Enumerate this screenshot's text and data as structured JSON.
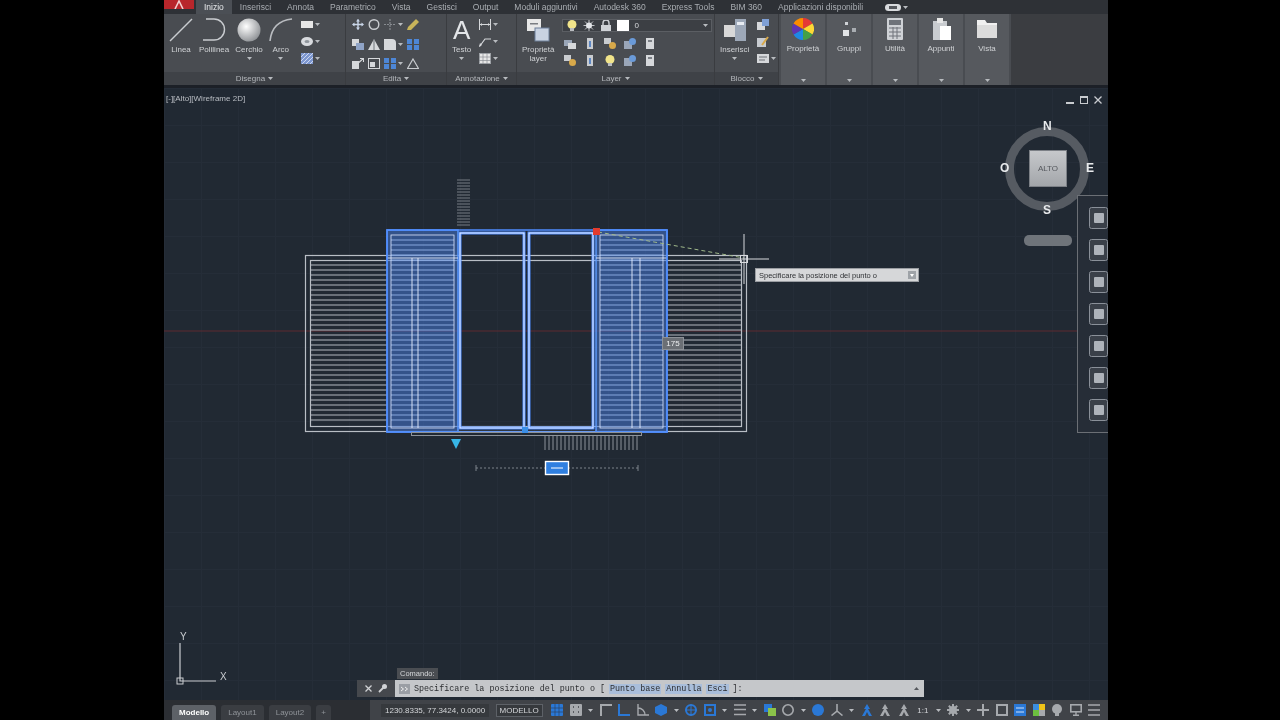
{
  "ribbon_tabs": [
    {
      "label": "Inizio",
      "selected": true
    },
    {
      "label": "Inserisci",
      "selected": false
    },
    {
      "label": "Annota",
      "selected": false
    },
    {
      "label": "Parametrico",
      "selected": false
    },
    {
      "label": "Vista",
      "selected": false
    },
    {
      "label": "Gestisci",
      "selected": false
    },
    {
      "label": "Output",
      "selected": false
    },
    {
      "label": "Moduli aggiuntivi",
      "selected": false
    },
    {
      "label": "Autodesk 360",
      "selected": false
    },
    {
      "label": "Express Tools",
      "selected": false
    },
    {
      "label": "BIM 360",
      "selected": false
    },
    {
      "label": "Applicazioni disponibili",
      "selected": false
    }
  ],
  "ribbon_panels": [
    {
      "kind": "draw",
      "title": "Disegna",
      "tools": [
        {
          "kind": "line",
          "label": "Linea",
          "menu": false
        },
        {
          "kind": "polyline",
          "label": "Polilinea",
          "menu": false
        },
        {
          "kind": "circle",
          "label": "Cerchio",
          "menu": true
        },
        {
          "kind": "arc",
          "label": "Arco",
          "menu": true
        }
      ]
    },
    {
      "kind": "edit",
      "title": "Edita"
    },
    {
      "kind": "annotation",
      "title": "Annotazione",
      "tools": [
        {
          "kind": "text",
          "glyph": "A",
          "label": "Testo",
          "menu": true
        }
      ]
    },
    {
      "kind": "layer",
      "title": "Layer",
      "tools": [
        {
          "kind": "layer-properties",
          "label": "Proprietà layer",
          "menu": false
        }
      ],
      "current_layer": "0"
    },
    {
      "kind": "block",
      "title": "Blocco",
      "tools": [
        {
          "kind": "insert",
          "label": "Inserisci",
          "menu": true
        }
      ]
    },
    {
      "kind": "properties",
      "label": "Proprietà"
    },
    {
      "kind": "groups",
      "label": "Gruppi"
    },
    {
      "kind": "utilities",
      "label": "Utilità"
    },
    {
      "kind": "clipboard",
      "label": "Appunti"
    },
    {
      "kind": "view",
      "label": "Vista"
    }
  ],
  "viewport": {
    "label": "[-][Alto][Wireframe 2D]",
    "viewcube": {
      "north": "N",
      "east": "E",
      "south": "S",
      "west": "O",
      "face": "ALTO"
    },
    "tooltip": "Specificare la posizione del punto o",
    "dimension_input": "175",
    "ucs": {
      "y": "Y",
      "x": "X"
    }
  },
  "command_line": {
    "history": "Comando:",
    "prompt": "Specificare la posizione del punto o [",
    "options": [
      "Punto base",
      "Annulla",
      "Esci"
    ],
    "suffix": "]:"
  },
  "layout_tabs": [
    {
      "label": "Modello",
      "selected": true
    },
    {
      "label": "Layout1",
      "selected": false
    },
    {
      "label": "Layout2",
      "selected": false
    }
  ],
  "add_layout": "+",
  "status_bar": {
    "coordinates": "1230.8335, 77.3424, 0.0000",
    "space": "MODELLO",
    "tools": [
      {
        "kind": "grid",
        "on": true,
        "menu": false
      },
      {
        "kind": "dots",
        "on": false,
        "menu": true
      },
      {
        "kind": "corner",
        "on": false,
        "menu": false
      },
      {
        "kind": "right-angle",
        "on": true,
        "menu": false
      },
      {
        "kind": "arc-angle",
        "on": false,
        "menu": false
      },
      {
        "kind": "hexagon",
        "on": true,
        "menu": true
      },
      {
        "kind": "target",
        "on": true,
        "menu": false
      },
      {
        "kind": "square-target",
        "on": true,
        "menu": true
      },
      {
        "kind": "lines",
        "on": false,
        "menu": true
      },
      {
        "kind": "overlap",
        "on": true,
        "menu": false
      },
      {
        "kind": "circle",
        "on": false,
        "menu": true
      },
      {
        "kind": "disc",
        "on": true,
        "menu": false
      },
      {
        "kind": "axes",
        "on": false,
        "menu": true
      },
      {
        "kind": "figure",
        "on": true,
        "menu": false
      },
      {
        "kind": "figure",
        "on": false,
        "menu": false
      },
      {
        "kind": "figure",
        "on": false,
        "menu": false
      },
      {
        "kind": "scale",
        "label": "1:1",
        "menu": true
      },
      {
        "kind": "gear",
        "on": false,
        "menu": true
      },
      {
        "kind": "plus",
        "on": false,
        "menu": false
      },
      {
        "kind": "box",
        "on": false,
        "menu": false
      },
      {
        "kind": "panel",
        "on": true,
        "menu": false
      },
      {
        "kind": "palette",
        "on": false,
        "menu": false
      },
      {
        "kind": "bulb",
        "on": false,
        "menu": false
      },
      {
        "kind": "monitor",
        "on": false,
        "menu": false
      },
      {
        "kind": "menu",
        "on": false,
        "menu": false
      }
    ]
  }
}
